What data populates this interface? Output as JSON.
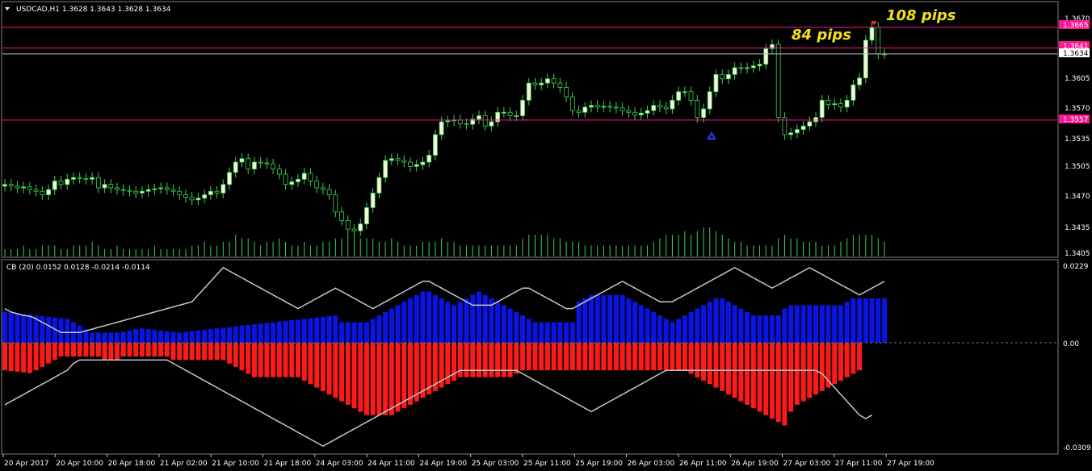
{
  "colors": {
    "background": "#000000",
    "bull_body": "#f5f5dc",
    "bear_body": "#000000",
    "wick": "#39d353",
    "volume": "#39d353",
    "level": "#ff1493",
    "current": "#c0c0c0",
    "upper_hist": "#0a14e6",
    "lower_hist": "#ff1a1a",
    "band": "#c8c8c8",
    "annotation": "#f0e01e",
    "axis": "#c0c0c0"
  },
  "main_panel": {
    "title": "USDCAD,H1  1.3628 1.3643 1.3628 1.3634",
    "price_ticks": [
      "1.3670",
      "1.3605",
      "1.3570",
      "1.3535",
      "1.3505",
      "1.3470",
      "1.3435",
      "1.3405"
    ],
    "level_tags": [
      "1.3665",
      "1.3641",
      "1.3557"
    ],
    "current_tag": "1.3634",
    "annotations": [
      "84 pips",
      "108 pips"
    ]
  },
  "indicator_panel": {
    "title": "CB (20) 0.0152 0.0128 -0.0214 -0.0114",
    "ticks": [
      "0.0229",
      "0.00",
      "-0.0309"
    ]
  },
  "time_labels": [
    "20 Apr 2017",
    "20 Apr 10:00",
    "20 Apr 18:00",
    "21 Apr 02:00",
    "21 Apr 10:00",
    "21 Apr 18:00",
    "24 Apr 03:00",
    "24 Apr 11:00",
    "24 Apr 19:00",
    "25 Apr 03:00",
    "25 Apr 11:00",
    "25 Apr 19:00",
    "26 Apr 03:00",
    "26 Apr 11:00",
    "26 Apr 19:00",
    "27 Apr 03:00",
    "27 Apr 11:00",
    "27 Apr 19:00"
  ],
  "chart_data": [
    {
      "type": "candlestick",
      "title": "USDCAD,H1",
      "ylim": [
        1.34,
        1.3678
      ],
      "levels": [
        1.3665,
        1.3641,
        1.3557
      ],
      "current": 1.3634,
      "close": [
        1.3482,
        1.348,
        1.3478,
        1.3479,
        1.3476,
        1.3474,
        1.347,
        1.3476,
        1.3486,
        1.3482,
        1.3488,
        1.349,
        1.3489,
        1.3488,
        1.349,
        1.3478,
        1.3482,
        1.3478,
        1.3476,
        1.3475,
        1.3474,
        1.3472,
        1.3474,
        1.3476,
        1.3477,
        1.3478,
        1.3476,
        1.3474,
        1.347,
        1.3467,
        1.3464,
        1.3466,
        1.347,
        1.3474,
        1.3472,
        1.3482,
        1.3496,
        1.3508,
        1.3512,
        1.35,
        1.3508,
        1.3507,
        1.3506,
        1.35,
        1.3494,
        1.3482,
        1.3485,
        1.3488,
        1.3495,
        1.3486,
        1.3478,
        1.3476,
        1.347,
        1.345,
        1.344,
        1.343,
        1.3428,
        1.3436,
        1.3455,
        1.3472,
        1.349,
        1.351,
        1.3512,
        1.351,
        1.3508,
        1.3503,
        1.3505,
        1.3508,
        1.3516,
        1.354,
        1.3555,
        1.3556,
        1.3557,
        1.3553,
        1.3552,
        1.3558,
        1.3562,
        1.355,
        1.3555,
        1.3566,
        1.3566,
        1.3562,
        1.3562,
        1.358,
        1.36,
        1.3598,
        1.36,
        1.3605,
        1.36,
        1.3595,
        1.3584,
        1.3568,
        1.3566,
        1.3572,
        1.3574,
        1.3572,
        1.3573,
        1.3572,
        1.3571,
        1.3568,
        1.3566,
        1.3563,
        1.3565,
        1.3568,
        1.3574,
        1.3572,
        1.357,
        1.358,
        1.359,
        1.359,
        1.358,
        1.356,
        1.357,
        1.359,
        1.361,
        1.3605,
        1.361,
        1.3618,
        1.3617,
        1.3618,
        1.362,
        1.3622,
        1.364,
        1.3645,
        1.356,
        1.354,
        1.3542,
        1.3546,
        1.355,
        1.3555,
        1.356,
        1.358,
        1.3575,
        1.3576,
        1.3572,
        1.358,
        1.3598,
        1.3606,
        1.365,
        1.3665,
        1.3634,
        1.3634
      ],
      "volume_relative": [
        0.2,
        0.2,
        0.2,
        0.3,
        0.2,
        0.2,
        0.3,
        0.3,
        0.3,
        0.2,
        0.2,
        0.3,
        0.3,
        0.3,
        0.4,
        0.3,
        0.2,
        0.2,
        0.3,
        0.2,
        0.2,
        0.2,
        0.2,
        0.2,
        0.3,
        0.2,
        0.2,
        0.2,
        0.2,
        0.2,
        0.3,
        0.3,
        0.4,
        0.3,
        0.3,
        0.4,
        0.4,
        0.6,
        0.5,
        0.5,
        0.4,
        0.3,
        0.4,
        0.4,
        0.5,
        0.4,
        0.3,
        0.3,
        0.4,
        0.3,
        0.3,
        0.4,
        0.4,
        0.5,
        0.5,
        0.6,
        0.6,
        0.5,
        0.5,
        0.5,
        0.4,
        0.4,
        0.5,
        0.4,
        0.3,
        0.3,
        0.3,
        0.4,
        0.4,
        0.4,
        0.5,
        0.4,
        0.4,
        0.3,
        0.3,
        0.3,
        0.3,
        0.3,
        0.3,
        0.3,
        0.3,
        0.3,
        0.3,
        0.5,
        0.6,
        0.6,
        0.6,
        0.6,
        0.5,
        0.5,
        0.4,
        0.4,
        0.4,
        0.3,
        0.3,
        0.3,
        0.3,
        0.3,
        0.3,
        0.3,
        0.3,
        0.3,
        0.3,
        0.3,
        0.4,
        0.5,
        0.6,
        0.6,
        0.6,
        0.7,
        0.6,
        0.7,
        0.8,
        0.8,
        0.7,
        0.6,
        0.5,
        0.4,
        0.4,
        0.3,
        0.3,
        0.3,
        0.3,
        0.3,
        0.5,
        0.6,
        0.5,
        0.5,
        0.4,
        0.4,
        0.4,
        0.3,
        0.3,
        0.3,
        0.4,
        0.5,
        0.6,
        0.6,
        0.6,
        0.6,
        0.5,
        0.4
      ]
    },
    {
      "type": "histogram",
      "title": "CB (20)",
      "ylim": [
        -0.0309,
        0.0229
      ],
      "upper": [
        0.009,
        0.0088,
        0.0086,
        0.0084,
        0.0082,
        0.008,
        0.0078,
        0.0076,
        0.0074,
        0.0072,
        0.007,
        0.006,
        0.005,
        0.004,
        0.003,
        0.003,
        0.003,
        0.003,
        0.003,
        0.0032,
        0.0036,
        0.004,
        0.0042,
        0.004,
        0.0038,
        0.0036,
        0.0034,
        0.0032,
        0.003,
        0.0032,
        0.0034,
        0.0036,
        0.0038,
        0.004,
        0.0042,
        0.0044,
        0.0046,
        0.0048,
        0.005,
        0.0052,
        0.0054,
        0.0056,
        0.0058,
        0.006,
        0.0062,
        0.0064,
        0.0066,
        0.0068,
        0.007,
        0.0072,
        0.0074,
        0.0076,
        0.0078,
        0.008,
        0.006,
        0.006,
        0.006,
        0.006,
        0.006,
        0.007,
        0.008,
        0.009,
        0.01,
        0.011,
        0.012,
        0.013,
        0.014,
        0.015,
        0.015,
        0.014,
        0.013,
        0.012,
        0.011,
        0.012,
        0.013,
        0.014,
        0.015,
        0.014,
        0.013,
        0.012,
        0.011,
        0.01,
        0.009,
        0.008,
        0.007,
        0.006,
        0.006,
        0.006,
        0.006,
        0.006,
        0.006,
        0.006,
        0.012,
        0.013,
        0.014,
        0.014,
        0.014,
        0.014,
        0.014,
        0.014,
        0.013,
        0.012,
        0.011,
        0.01,
        0.009,
        0.008,
        0.007,
        0.006,
        0.007,
        0.008,
        0.009,
        0.01,
        0.011,
        0.012,
        0.013,
        0.013,
        0.012,
        0.011,
        0.01,
        0.009,
        0.008,
        0.008,
        0.008,
        0.008,
        0.008,
        0.01,
        0.011,
        0.011,
        0.011,
        0.011,
        0.011,
        0.011,
        0.011,
        0.011,
        0.011,
        0.012,
        0.013,
        0.013,
        0.013,
        0.013,
        0.013,
        0.013
      ],
      "lower": [
        -0.008,
        -0.0082,
        -0.0084,
        -0.0086,
        -0.0088,
        -0.008,
        -0.007,
        -0.006,
        -0.005,
        -0.004,
        -0.004,
        -0.004,
        -0.004,
        -0.004,
        -0.004,
        -0.004,
        -0.005,
        -0.005,
        -0.005,
        -0.004,
        -0.004,
        -0.004,
        -0.004,
        -0.004,
        -0.004,
        -0.004,
        -0.004,
        -0.005,
        -0.005,
        -0.005,
        -0.005,
        -0.005,
        -0.005,
        -0.005,
        -0.005,
        -0.005,
        -0.006,
        -0.007,
        -0.008,
        -0.009,
        -0.01,
        -0.01,
        -0.01,
        -0.01,
        -0.01,
        -0.01,
        -0.01,
        -0.01,
        -0.011,
        -0.012,
        -0.013,
        -0.014,
        -0.015,
        -0.016,
        -0.017,
        -0.018,
        -0.019,
        -0.02,
        -0.021,
        -0.021,
        -0.021,
        -0.021,
        -0.021,
        -0.02,
        -0.019,
        -0.018,
        -0.017,
        -0.016,
        -0.015,
        -0.014,
        -0.013,
        -0.012,
        -0.011,
        -0.01,
        -0.01,
        -0.01,
        -0.01,
        -0.01,
        -0.01,
        -0.01,
        -0.01,
        -0.01,
        -0.009,
        -0.008,
        -0.008,
        -0.008,
        -0.008,
        -0.008,
        -0.008,
        -0.008,
        -0.008,
        -0.008,
        -0.008,
        -0.008,
        -0.008,
        -0.008,
        -0.008,
        -0.008,
        -0.008,
        -0.008,
        -0.008,
        -0.008,
        -0.008,
        -0.008,
        -0.008,
        -0.008,
        -0.008,
        -0.008,
        -0.008,
        -0.008,
        -0.009,
        -0.01,
        -0.011,
        -0.012,
        -0.013,
        -0.014,
        -0.015,
        -0.016,
        -0.017,
        -0.018,
        -0.019,
        -0.02,
        -0.021,
        -0.022,
        -0.023,
        -0.024,
        -0.02,
        -0.018,
        -0.017,
        -0.016,
        -0.015,
        -0.014,
        -0.013,
        -0.012,
        -0.011,
        -0.01,
        -0.009,
        -0.008
      ],
      "band_upper": [
        0.01,
        0.009,
        0.0085,
        0.008,
        0.0078,
        0.007,
        0.006,
        0.005,
        0.004,
        0.003,
        0.003,
        0.003,
        0.003,
        0.0035,
        0.004,
        0.0045,
        0.005,
        0.0055,
        0.006,
        0.0065,
        0.007,
        0.0075,
        0.008,
        0.0085,
        0.009,
        0.0095,
        0.01,
        0.0105,
        0.011,
        0.0115,
        0.012,
        0.014,
        0.016,
        0.018,
        0.02,
        0.022,
        0.021,
        0.02,
        0.019,
        0.018,
        0.017,
        0.016,
        0.015,
        0.014,
        0.013,
        0.012,
        0.011,
        0.01,
        0.011,
        0.012,
        0.013,
        0.014,
        0.015,
        0.016,
        0.015,
        0.014,
        0.013,
        0.012,
        0.011,
        0.01,
        0.011,
        0.012,
        0.013,
        0.014,
        0.015,
        0.016,
        0.017,
        0.018,
        0.018,
        0.017,
        0.016,
        0.015,
        0.014,
        0.013,
        0.012,
        0.011,
        0.011,
        0.011,
        0.011,
        0.012,
        0.013,
        0.014,
        0.015,
        0.016,
        0.016,
        0.015,
        0.014,
        0.013,
        0.012,
        0.011,
        0.01,
        0.01,
        0.011,
        0.012,
        0.013,
        0.014,
        0.015,
        0.016,
        0.017,
        0.018,
        0.017,
        0.016,
        0.015,
        0.014,
        0.013,
        0.012,
        0.012,
        0.012,
        0.013,
        0.014,
        0.015,
        0.016,
        0.017,
        0.018,
        0.019,
        0.02,
        0.021,
        0.022,
        0.021,
        0.02,
        0.019,
        0.018,
        0.017,
        0.016,
        0.017,
        0.018,
        0.019,
        0.02,
        0.021,
        0.022,
        0.021,
        0.02,
        0.019,
        0.018,
        0.017,
        0.016,
        0.015,
        0.014,
        0.015,
        0.016,
        0.017,
        0.018
      ],
      "band_lower": [
        -0.018,
        -0.017,
        -0.016,
        -0.015,
        -0.014,
        -0.013,
        -0.012,
        -0.011,
        -0.01,
        -0.009,
        -0.008,
        -0.006,
        -0.005,
        -0.005,
        -0.005,
        -0.005,
        -0.005,
        -0.005,
        -0.005,
        -0.005,
        -0.005,
        -0.005,
        -0.005,
        -0.005,
        -0.005,
        -0.005,
        -0.005,
        -0.006,
        -0.007,
        -0.008,
        -0.009,
        -0.01,
        -0.011,
        -0.012,
        -0.013,
        -0.014,
        -0.015,
        -0.016,
        -0.017,
        -0.018,
        -0.019,
        -0.02,
        -0.021,
        -0.022,
        -0.023,
        -0.024,
        -0.025,
        -0.026,
        -0.027,
        -0.028,
        -0.029,
        -0.03,
        -0.029,
        -0.028,
        -0.027,
        -0.026,
        -0.025,
        -0.024,
        -0.023,
        -0.022,
        -0.021,
        -0.02,
        -0.019,
        -0.018,
        -0.017,
        -0.016,
        -0.015,
        -0.014,
        -0.013,
        -0.012,
        -0.011,
        -0.01,
        -0.009,
        -0.008,
        -0.008,
        -0.008,
        -0.008,
        -0.008,
        -0.008,
        -0.008,
        -0.008,
        -0.008,
        -0.008,
        -0.009,
        -0.01,
        -0.011,
        -0.012,
        -0.013,
        -0.014,
        -0.015,
        -0.016,
        -0.017,
        -0.018,
        -0.019,
        -0.02,
        -0.019,
        -0.018,
        -0.017,
        -0.016,
        -0.015,
        -0.014,
        -0.013,
        -0.012,
        -0.011,
        -0.01,
        -0.009,
        -0.008,
        -0.008,
        -0.008,
        -0.008,
        -0.008,
        -0.008,
        -0.008,
        -0.008,
        -0.008,
        -0.008,
        -0.008,
        -0.008,
        -0.008,
        -0.008,
        -0.008,
        -0.008,
        -0.008,
        -0.008,
        -0.008,
        -0.008,
        -0.008,
        -0.008,
        -0.008,
        -0.008,
        -0.008,
        -0.009,
        -0.011,
        -0.013,
        -0.015,
        -0.017,
        -0.019,
        -0.021,
        -0.022,
        -0.021
      ]
    }
  ]
}
